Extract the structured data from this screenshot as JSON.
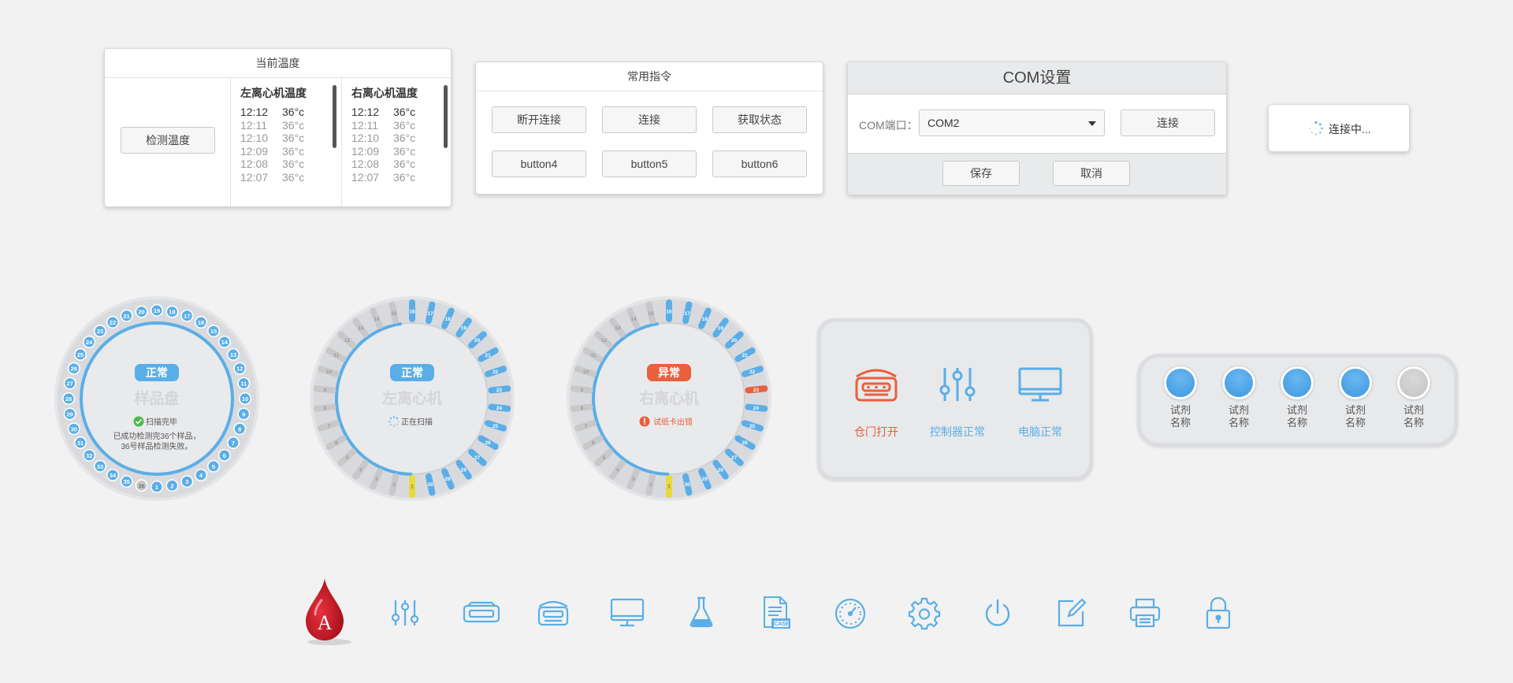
{
  "temp_panel": {
    "title": "当前温度",
    "detect_button": "检测温度",
    "left": {
      "title": "左离心机温度",
      "rows": [
        {
          "time": "12:12",
          "temp": "36°c"
        },
        {
          "time": "12:11",
          "temp": "36°c"
        },
        {
          "time": "12:10",
          "temp": "36°c"
        },
        {
          "time": "12:09",
          "temp": "36°c"
        },
        {
          "time": "12:08",
          "temp": "36°c"
        },
        {
          "time": "12:07",
          "temp": "36°c"
        }
      ]
    },
    "right": {
      "title": "右离心机温度",
      "rows": [
        {
          "time": "12:12",
          "temp": "36°c"
        },
        {
          "time": "12:11",
          "temp": "36°c"
        },
        {
          "time": "12:10",
          "temp": "36°c"
        },
        {
          "time": "12:09",
          "temp": "36°c"
        },
        {
          "time": "12:08",
          "temp": "36°c"
        },
        {
          "time": "12:07",
          "temp": "36°c"
        }
      ]
    }
  },
  "cmd_panel": {
    "title": "常用指令",
    "buttons": [
      "断开连接",
      "连接",
      "获取状态",
      "button4",
      "button5",
      "button6"
    ]
  },
  "com_panel": {
    "title": "COM设置",
    "port_label": "COM端口：",
    "port_value": "COM2",
    "connect": "连接",
    "save": "保存",
    "cancel": "取消"
  },
  "connecting": {
    "text": "连接中..."
  },
  "dials": [
    {
      "badge": "正常",
      "badge_color": "#5aaee8",
      "name": "样品盘",
      "status": "扫描完毕",
      "status_type": "ok",
      "note1": "已成功检测完36个样品，",
      "note2": "36号样品检测失败。"
    },
    {
      "badge": "正常",
      "badge_color": "#5aaee8",
      "name": "左离心机",
      "status": "正在扫描",
      "status_type": "scan"
    },
    {
      "badge": "异常",
      "badge_color": "#e8603c",
      "name": "右离心机",
      "status": "试纸卡出错",
      "status_type": "error"
    }
  ],
  "status_panel": {
    "items": [
      {
        "label": "仓门打开",
        "icon": "door-open-icon",
        "color": "#e8603c"
      },
      {
        "label": "控制器正常",
        "icon": "controller-icon",
        "color": "#5aaee8"
      },
      {
        "label": "电脑正常",
        "icon": "monitor-icon",
        "color": "#5aaee8"
      }
    ]
  },
  "reagents": [
    {
      "label": "试剂\n名称",
      "active": true
    },
    {
      "label": "试剂\n名称",
      "active": true
    },
    {
      "label": "试剂\n名称",
      "active": true
    },
    {
      "label": "试剂\n名称",
      "active": true
    },
    {
      "label": "试剂\n名称",
      "active": false
    }
  ],
  "toolbar_icons": [
    "blood-drop-icon",
    "sliders-icon",
    "tray-icon",
    "open-box-icon",
    "monitor-icon",
    "flask-icon",
    "case-file-icon",
    "gauge-icon",
    "gear-icon",
    "power-icon",
    "edit-icon",
    "printer-icon",
    "lock-icon"
  ],
  "logo_letter": "A",
  "colors": {
    "accent": "#5aaee8",
    "error": "#e8603c",
    "warning": "#e8d93c",
    "muted": "#c8c8c8"
  }
}
